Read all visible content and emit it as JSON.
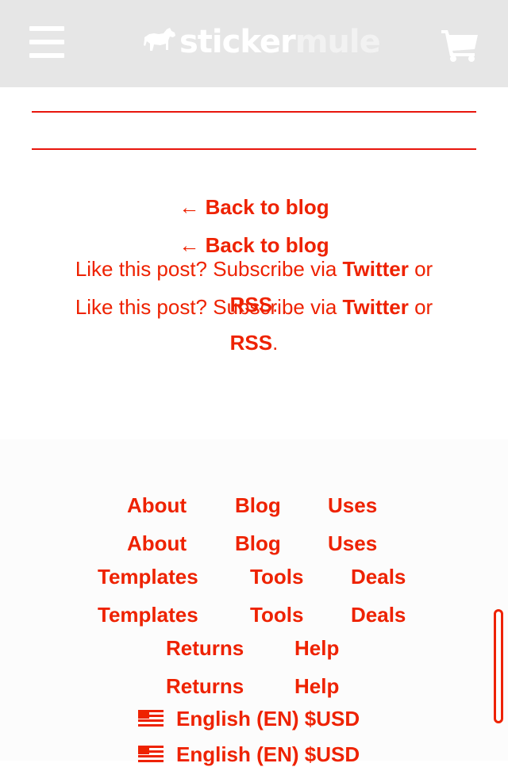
{
  "header": {
    "logo": {
      "part1": "sticker",
      "part2": "mule"
    },
    "menu_icon": "hamburger-menu-icon",
    "cart_icon": "shopping-cart-icon",
    "background": "#e6e6e6"
  },
  "article_footer": {
    "back_link": "← Back to blog",
    "subscribe_prefix": "Like this post? Subscribe via ",
    "twitter": "Twitter",
    "or": " or",
    "rss": "RSS",
    "period": "."
  },
  "footer": {
    "row1": [
      "About",
      "Blog",
      "Uses"
    ],
    "row2": [
      "Templates",
      "Tools",
      "Deals"
    ],
    "row3": [
      "Returns",
      "Help"
    ],
    "language": "English (EN) $USD",
    "flag_icon": "us-flag-icon"
  },
  "colors": {
    "accent": "#ee2200",
    "rule": "#e8160c",
    "footer_bg": "#fcfcfc"
  }
}
